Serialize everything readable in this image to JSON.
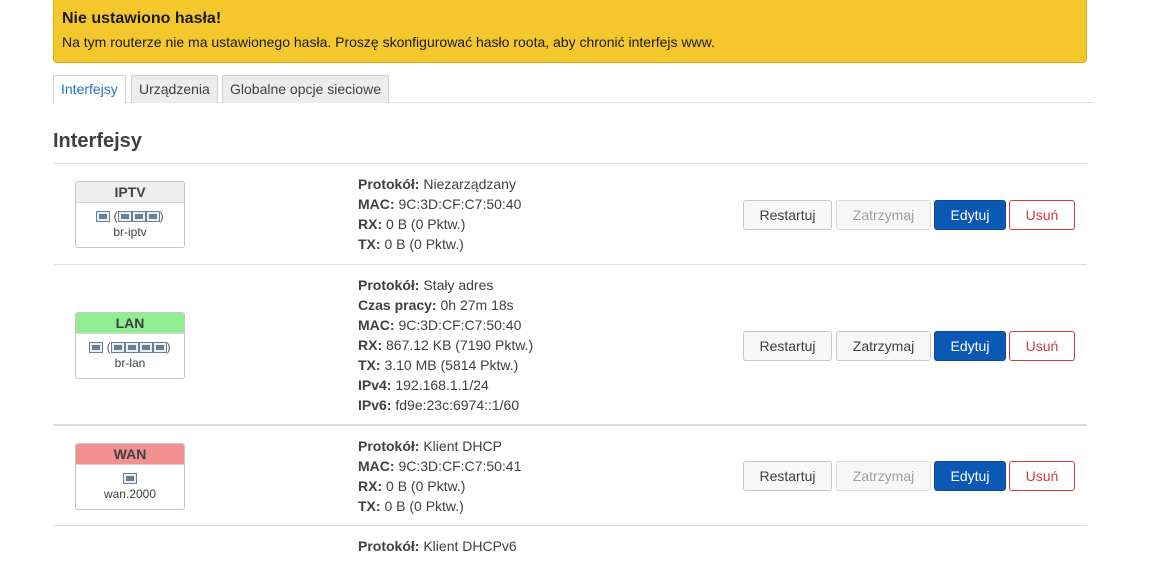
{
  "alert": {
    "title": "Nie ustawiono hasła!",
    "text": "Na tym routerze nie ma ustawionego hasła. Proszę skonfigurować hasło roota, aby chronić interfejs www."
  },
  "tabs": [
    {
      "label": "Interfejsy",
      "active": true
    },
    {
      "label": "Urządzenia",
      "active": false
    },
    {
      "label": "Globalne opcje sieciowe",
      "active": false
    }
  ],
  "section_title": "Interfejsy",
  "colors": {
    "alert_bg": "#f4c82c",
    "lan_badge": "#90ee90",
    "wan_badge": "#f09090",
    "iptv_badge": "#eeeeee",
    "edit_button": "#0c59b5",
    "delete_border": "#d43b3b",
    "tab_active_text": "#2276c6"
  },
  "interfaces": [
    {
      "name": "IPTV",
      "device": "br-iptv",
      "icons": "bridge-icon (ethernet-port-icons)",
      "info": [
        {
          "k": "Protokół:",
          "v": "Niezarządzany"
        },
        {
          "k": "MAC:",
          "v": "9C:3D:CF:C7:50:40"
        },
        {
          "k": "RX:",
          "v": "0 B (0 Pktw.)"
        },
        {
          "k": "TX:",
          "v": "0 B (0 Pktw.)"
        }
      ],
      "buttons": {
        "restart": "Restartuj",
        "stop": "Zatrzymaj",
        "stop_disabled": true,
        "edit": "Edytuj",
        "delete": "Usuń"
      }
    },
    {
      "name": "LAN",
      "device": "br-lan",
      "icons": "bridge-icon (ethernet-port-icons)",
      "info": [
        {
          "k": "Protokół:",
          "v": "Stały adres"
        },
        {
          "k": "Czas pracy:",
          "v": "0h 27m 18s"
        },
        {
          "k": "MAC:",
          "v": "9C:3D:CF:C7:50:40"
        },
        {
          "k": "RX:",
          "v": "867.12 KB (7190 Pktw.)"
        },
        {
          "k": "TX:",
          "v": "3.10 MB (5814 Pktw.)"
        },
        {
          "k": "IPv4:",
          "v": "192.168.1.1/24"
        },
        {
          "k": "IPv6:",
          "v": "fd9e:23c:6974::1/60"
        }
      ],
      "buttons": {
        "restart": "Restartuj",
        "stop": "Zatrzymaj",
        "stop_disabled": false,
        "edit": "Edytuj",
        "delete": "Usuń"
      }
    },
    {
      "name": "WAN",
      "device": "wan.2000",
      "icons": "ethernet-port-icon",
      "info": [
        {
          "k": "Protokół:",
          "v": "Klient DHCP"
        },
        {
          "k": "MAC:",
          "v": "9C:3D:CF:C7:50:41"
        },
        {
          "k": "RX:",
          "v": "0 B (0 Pktw.)"
        },
        {
          "k": "TX:",
          "v": "0 B (0 Pktw.)"
        }
      ],
      "buttons": {
        "restart": "Restartuj",
        "stop": "Zatrzymaj",
        "stop_disabled": true,
        "edit": "Edytuj",
        "delete": "Usuń"
      }
    }
  ],
  "partial_row_text": {
    "k": "Protokół:",
    "v": "Klient DHCPv6"
  }
}
